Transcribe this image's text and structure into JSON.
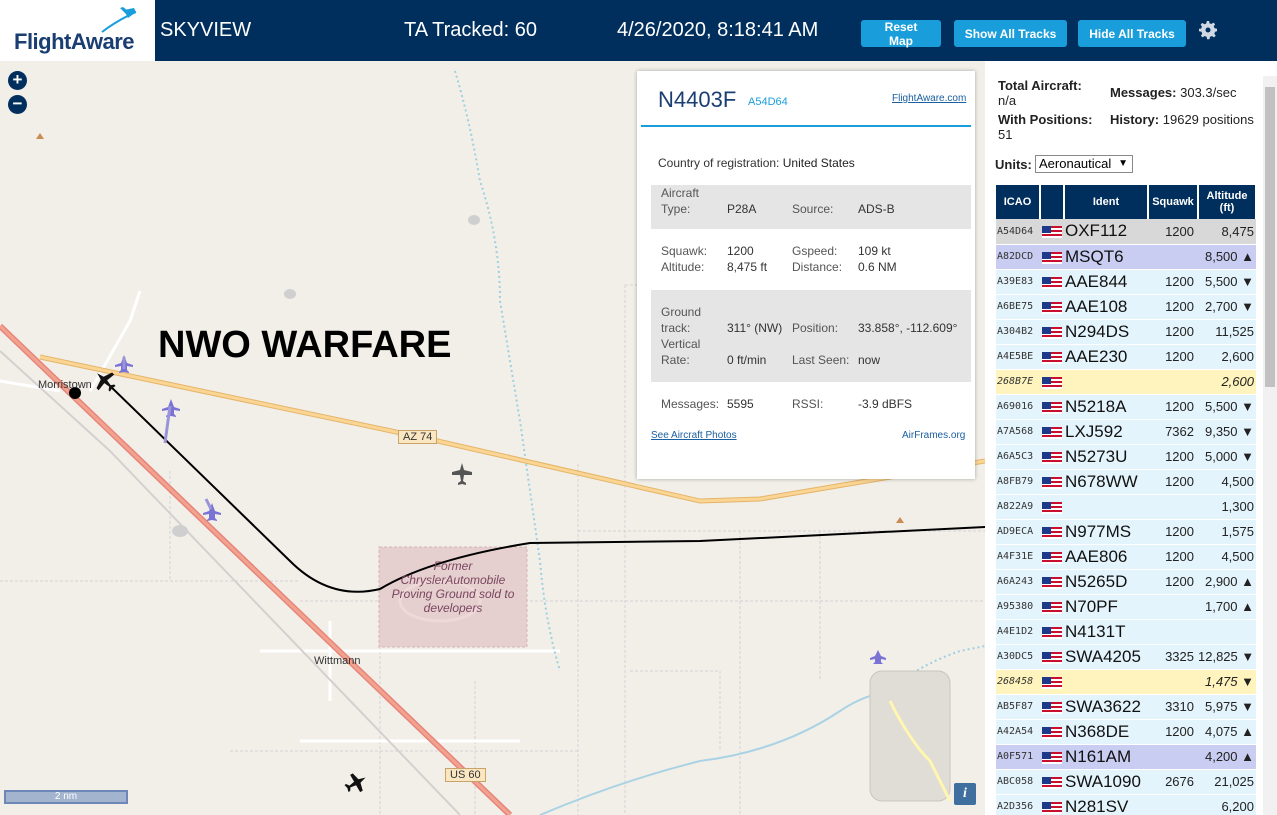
{
  "header": {
    "logo_text": "FlightAware",
    "app_title": "SKYVIEW",
    "ta_tracked": "TA Tracked: 60",
    "datetime": "4/26/2020, 8:18:41 AM",
    "reset_map": "Reset Map",
    "show_all_tracks": "Show All Tracks",
    "hide_all_tracks": "Hide All Tracks",
    "settings_icon": "gear-icon"
  },
  "map": {
    "overlay_text": "NWO WARFARE",
    "labels": {
      "morristown": "Morristown",
      "wittmann": "Wittmann",
      "az74": "AZ 74",
      "us60": "US 60",
      "chrysler": "Former ChryslerAutomobile Proving Ground sold to developers",
      "scale": "2 nm",
      "info": "i"
    },
    "colors": {
      "land": "#f2efe9",
      "highway": "#f6c580",
      "track": "#000000"
    }
  },
  "popup": {
    "callsign": "N4403F",
    "hex": "A54D64",
    "fa_link": "FlightAware.com",
    "country_label": "Country of registration:",
    "country_value": "United States",
    "aircraft_type_label": "Aircraft Type:",
    "aircraft_type_value": "P28A",
    "source_label": "Source:",
    "source_value": "ADS-B",
    "squawk_label": "Squawk:",
    "squawk_value": "1200",
    "gspeed_label": "Gspeed:",
    "gspeed_value": "109 kt",
    "altitude_label": "Altitude:",
    "altitude_value": "8,475 ft",
    "distance_label": "Distance:",
    "distance_value": "0.6 NM",
    "ground_track_label": "Ground track:",
    "ground_track_value": "311° (NW)",
    "position_label": "Position:",
    "position_value": "33.858°, -112.609°",
    "vertical_rate_label": "Vertical Rate:",
    "vertical_rate_value": "0 ft/min",
    "last_seen_label": "Last Seen:",
    "last_seen_value": "now",
    "messages_label": "Messages:",
    "messages_value": "5595",
    "rssi_label": "RSSI:",
    "rssi_value": "-3.9 dBFS",
    "photos_link": "See Aircraft Photos",
    "airframes_link": "AirFrames.org"
  },
  "sidebar": {
    "total_aircraft_label": "Total Aircraft:",
    "total_aircraft_value": "n/a",
    "messages_label": "Messages:",
    "messages_value": "303.3/sec",
    "with_positions_label": "With Positions:",
    "with_positions_value": "51",
    "history_label": "History:",
    "history_value": "19629 positions",
    "units_label": "Units:",
    "units_value": "Aeronautical",
    "columns": [
      "ICAO",
      "",
      "Ident",
      "Squawk",
      "Altitude (ft)"
    ],
    "rows": [
      {
        "icao": "A54D64",
        "ident": "OXF112",
        "squawk": "1200",
        "alt": "8,475",
        "style": "sel"
      },
      {
        "icao": "A82DCD",
        "ident": "MSQT6",
        "squawk": "",
        "alt": "8,500 ▲",
        "style": "hl"
      },
      {
        "icao": "A39E83",
        "ident": "AAE844",
        "squawk": "1200",
        "alt": "5,500 ▼",
        "style": "plain"
      },
      {
        "icao": "A6BE75",
        "ident": "AAE108",
        "squawk": "1200",
        "alt": "2,700 ▼",
        "style": "plain"
      },
      {
        "icao": "A304B2",
        "ident": "N294DS",
        "squawk": "1200",
        "alt": "11,525",
        "style": "plain"
      },
      {
        "icao": "A4E5BE",
        "ident": "AAE230",
        "squawk": "1200",
        "alt": "2,600",
        "style": "plain"
      },
      {
        "icao": "268B7E",
        "ident": "",
        "squawk": "",
        "alt": "2,600",
        "style": "mlat"
      },
      {
        "icao": "A69016",
        "ident": "N5218A",
        "squawk": "1200",
        "alt": "5,500 ▼",
        "style": "plain"
      },
      {
        "icao": "A7A568",
        "ident": "LXJ592",
        "squawk": "7362",
        "alt": "9,350 ▼",
        "style": "plain"
      },
      {
        "icao": "A6A5C3",
        "ident": "N5273U",
        "squawk": "1200",
        "alt": "5,000 ▼",
        "style": "plain"
      },
      {
        "icao": "A8FB79",
        "ident": "N678WW",
        "squawk": "1200",
        "alt": "4,500",
        "style": "plain"
      },
      {
        "icao": "A822A9",
        "ident": "",
        "squawk": "",
        "alt": "1,300",
        "style": "plain"
      },
      {
        "icao": "AD9ECA",
        "ident": "N977MS",
        "squawk": "1200",
        "alt": "1,575",
        "style": "plain"
      },
      {
        "icao": "A4F31E",
        "ident": "AAE806",
        "squawk": "1200",
        "alt": "4,500",
        "style": "plain"
      },
      {
        "icao": "A6A243",
        "ident": "N5265D",
        "squawk": "1200",
        "alt": "2,900 ▲",
        "style": "plain"
      },
      {
        "icao": "A95380",
        "ident": "N70PF",
        "squawk": "",
        "alt": "1,700 ▲",
        "style": "plain"
      },
      {
        "icao": "A4E1D2",
        "ident": "N4131T",
        "squawk": "",
        "alt": "",
        "style": "plain"
      },
      {
        "icao": "A30DC5",
        "ident": "SWA4205",
        "squawk": "3325",
        "alt": "12,825 ▼",
        "style": "plain"
      },
      {
        "icao": "268458",
        "ident": "",
        "squawk": "",
        "alt": "1,475 ▼",
        "style": "mlat"
      },
      {
        "icao": "AB5F87",
        "ident": "SWA3622",
        "squawk": "3310",
        "alt": "5,975 ▼",
        "style": "plain"
      },
      {
        "icao": "A42A54",
        "ident": "N368DE",
        "squawk": "1200",
        "alt": "4,075 ▲",
        "style": "plain"
      },
      {
        "icao": "A0F571",
        "ident": "N161AM",
        "squawk": "",
        "alt": "4,200 ▲",
        "style": "hl"
      },
      {
        "icao": "ABC058",
        "ident": "SWA1090",
        "squawk": "2676",
        "alt": "21,025",
        "style": "plain"
      },
      {
        "icao": "A2D356",
        "ident": "N281SV",
        "squawk": "",
        "alt": "6,200",
        "style": "plain"
      }
    ]
  }
}
